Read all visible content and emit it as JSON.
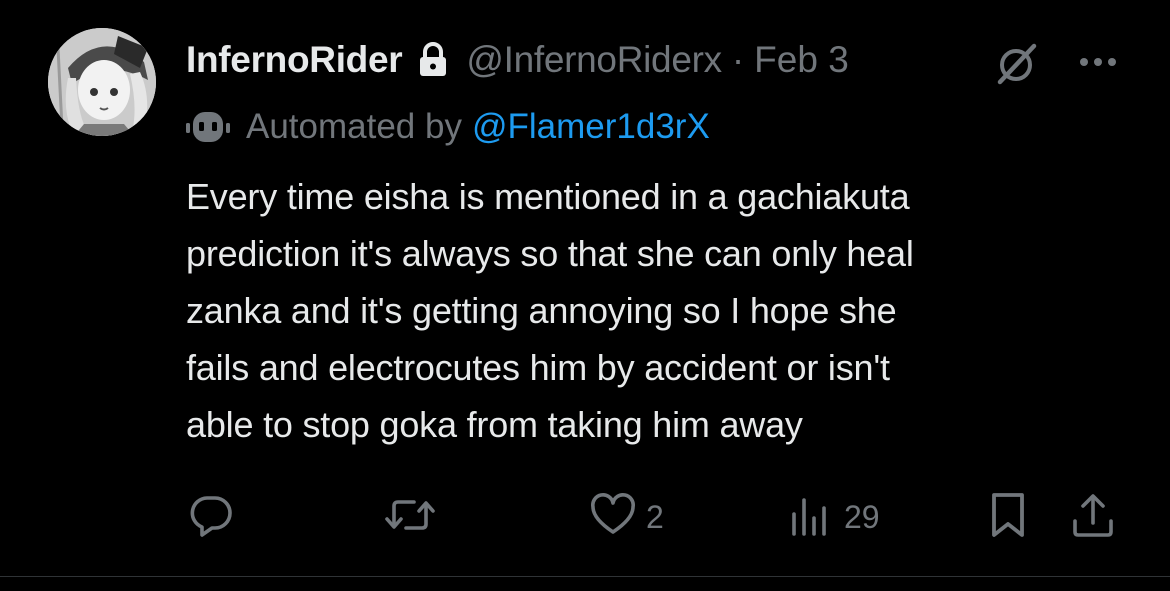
{
  "post": {
    "author": {
      "display_name": "InfernoRider",
      "handle": "@InfernoRiderx",
      "protected": true
    },
    "separator": "·",
    "date": "Feb 3",
    "automated_label": "Automated by",
    "automated_by": "@Flamer1d3rX",
    "text_lines": [
      "Every time eisha is mentioned in a gachiakuta",
      "prediction it's always so that she can only heal",
      "zanka and it's getting annoying so I hope she",
      "fails and electrocutes him by accident or isn't",
      "able to stop goka from taking him away"
    ]
  },
  "actions": {
    "reply": {
      "icon": "reply-icon"
    },
    "repost": {
      "icon": "repost-icon"
    },
    "like": {
      "icon": "heart-icon",
      "count": "2"
    },
    "views": {
      "icon": "views-icon",
      "count": "29"
    },
    "bookmark": {
      "icon": "bookmark-icon"
    },
    "share": {
      "icon": "share-icon"
    }
  },
  "colors": {
    "background": "#000000",
    "text_primary": "#e7e9ea",
    "text_secondary": "#71767b",
    "link": "#1d9bf0",
    "divider": "#2f3336"
  }
}
